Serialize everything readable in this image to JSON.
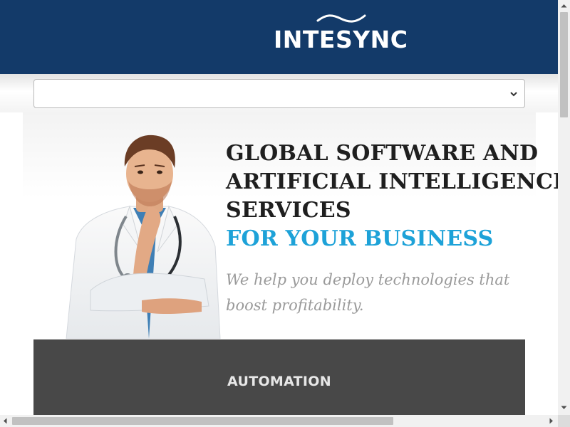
{
  "header": {
    "logo_text": "INTESYNC",
    "background_color": "#133a69"
  },
  "nav": {
    "select_value": "",
    "icon": "chevron-down-icon"
  },
  "hero": {
    "headline_lines": [
      "GLOBAL SOFTWARE AND",
      "ARTIFICIAL INTELLIGENCE",
      "SERVICES"
    ],
    "headline_accent": "FOR YOUR BUSINESS",
    "tagline": "We help you deploy technologies that boost profitability.",
    "accent_color": "#1da2d8",
    "image": "doctor-with-stethoscope"
  },
  "services": {
    "first_title": "AUTOMATION",
    "panel_color": "#484848"
  },
  "scrollbars": {
    "vertical": true,
    "horizontal": true
  }
}
